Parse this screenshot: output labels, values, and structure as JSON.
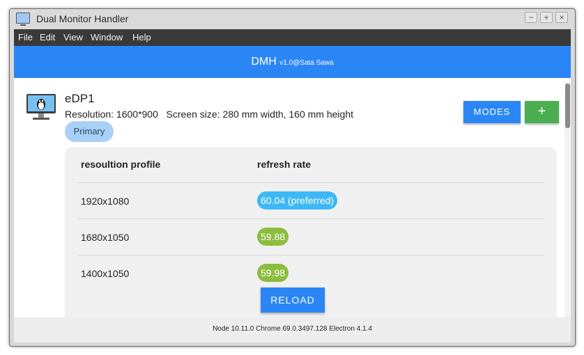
{
  "window": {
    "title": "Dual Monitor Handler",
    "controls": {
      "minimize": "−",
      "maximize": "+",
      "close": "×"
    }
  },
  "menu": {
    "items": [
      "File",
      "Edit",
      "View",
      "Window",
      "Help"
    ]
  },
  "header": {
    "app_name": "DMH",
    "version": "v1.0@Sata Sawa",
    "color": "#2b86f5"
  },
  "display": {
    "name": "eDP1",
    "info": "Resolution: 1600*900   Screen size: 280 mm width, 160 mm height",
    "badge": "Primary",
    "modes_label": "MODES",
    "add_label": "+"
  },
  "table": {
    "headers": {
      "profile": "resoultion profile",
      "rate": "refresh rate"
    },
    "rows": [
      {
        "resolution": "1920x1080",
        "rate": "60.04 (preferred)",
        "rate_color": "#3db8f5"
      },
      {
        "resolution": "1680x1050",
        "rate": "59.88",
        "rate_color": "#8cbc3f"
      },
      {
        "resolution": "1400x1050",
        "rate": "59.98",
        "rate_color": "#8cbc3f"
      }
    ]
  },
  "reload_label": "RELOAD",
  "footer": {
    "text": "Node 10.11.0 Chrome 69.0.3497.128 Electron 4.1.4"
  }
}
